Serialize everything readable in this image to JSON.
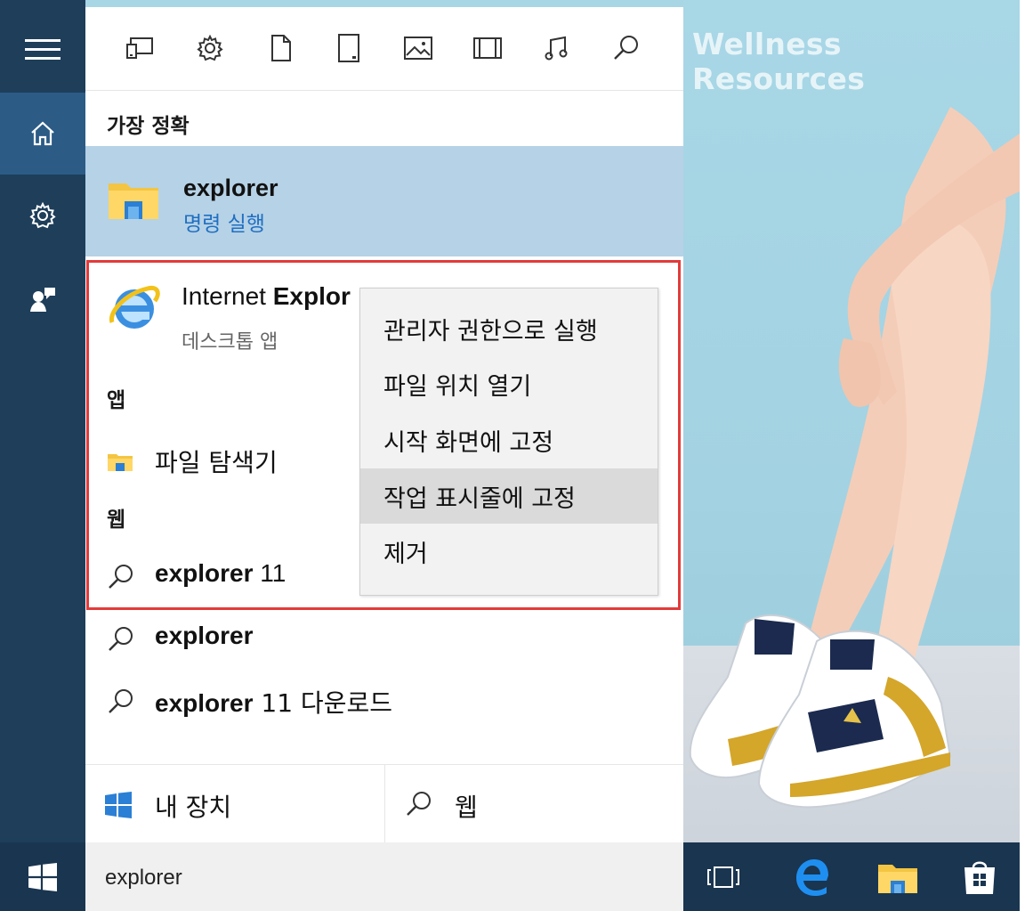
{
  "watermark": "Wellness Resources",
  "toolbar": {
    "icons": [
      "apps-icon",
      "settings-icon",
      "document-icon",
      "tablet-icon",
      "photo-icon",
      "video-icon",
      "music-icon",
      "search-icon"
    ]
  },
  "best_match": {
    "header": "가장 정확",
    "title": "explorer",
    "subtitle": "명령 실행"
  },
  "results": {
    "ie": {
      "name_regular": "Internet ",
      "name_bold": "Explor",
      "type": "데스크톱 앱"
    },
    "apps_header": "앱",
    "file_explorer": "파일 탐색기",
    "web_header": "웹",
    "web_items": [
      {
        "bold": "explorer",
        "rest": " 11"
      },
      {
        "bold": "explorer",
        "rest": ""
      },
      {
        "bold": "explorer",
        "rest": " 11 다운로드"
      }
    ]
  },
  "context_menu": {
    "items": [
      "관리자 권한으로 실행",
      "파일 위치 열기",
      "시작 화면에 고정",
      "작업 표시줄에 고정",
      "제거"
    ],
    "hovered_index": 3
  },
  "bottom_tabs": {
    "my_device": "내 장치",
    "web": "웹"
  },
  "search": {
    "value": "explorer"
  },
  "colors": {
    "rail": "#1e3e5a",
    "rail_active": "#2c5b86",
    "best_match_band": "#b6d2e6",
    "accent_link": "#1f6fc2",
    "outline": "#e23b3b",
    "taskbar": "#1a3550"
  }
}
